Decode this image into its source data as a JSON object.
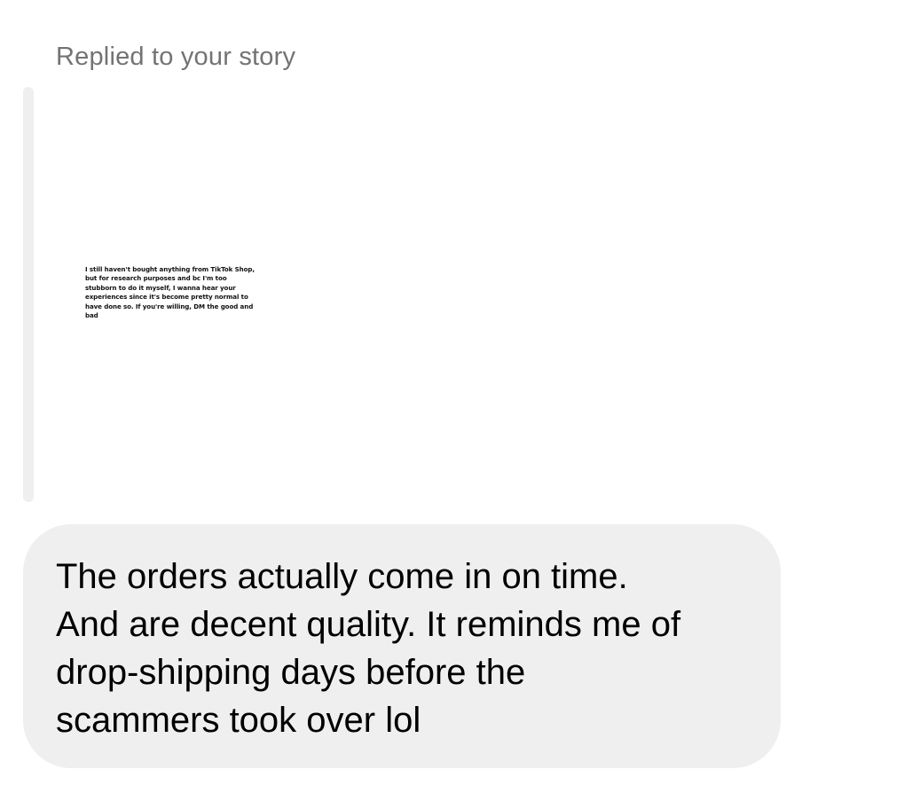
{
  "conversation": {
    "reply_label": "Replied to your story",
    "story": {
      "text": "I still haven't bought anything from TikTok Shop, but for research purposes and bc I'm too stubborn to do it myself, I wanna hear your experiences since it's become pretty normal to have done so. If you're willing, DM the good and bad"
    },
    "message": {
      "text": "The orders actually come in on time.\nAnd are decent quality. It reminds me of\ndrop-shipping days before the\nscammers took over lol"
    }
  },
  "colors": {
    "label_gray": "#737373",
    "bubble_background": "#efefef",
    "story_bar": "#efefef",
    "text": "#000000"
  }
}
